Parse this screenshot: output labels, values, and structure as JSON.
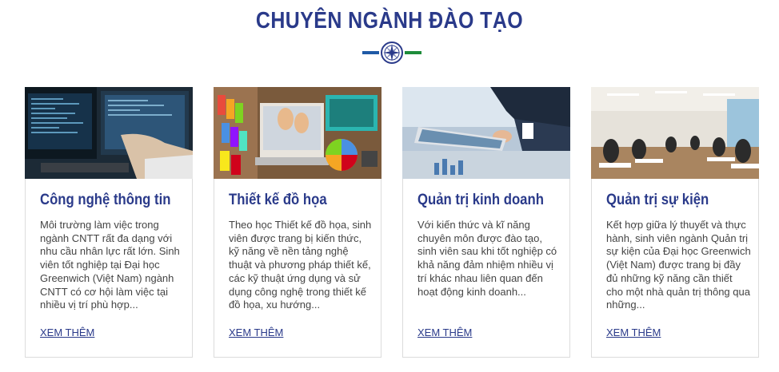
{
  "section": {
    "title": "CHUYÊN NGÀNH ĐÀO TẠO"
  },
  "colors": {
    "title": "#2a3a8a",
    "divider_left": "#1f5aa6",
    "divider_right": "#1e8c3a",
    "text": "#444444"
  },
  "cards": [
    {
      "title": "Công nghệ thông tin",
      "description": "Môi trường làm việc trong ngành CNTT rất đa dạng với nhu cầu nhân lực rất lớn. Sinh viên tốt nghiệp tại Đại học Greenwich (Việt Nam) ngành CNTT có cơ hội làm việc tại nhiều vị trí phù hợp...",
      "link": "XEM THÊM"
    },
    {
      "title": "Thiết kế đồ họa",
      "description": "Theo học Thiết kế đồ họa, sinh viên được trang bị kiến thức, kỹ năng về nền tảng nghệ thuật và phương pháp thiết kế, các kỹ thuật ứng dụng và sử dụng công nghệ trong thiết kế đồ họa, xu hướng...",
      "link": "XEM THÊM"
    },
    {
      "title": "Quản trị kinh doanh",
      "description": "Với kiến thức và kĩ năng chuyên môn được đào tạo, sinh viên sau khi tốt nghiệp có khả năng đảm nhiệm nhiều vị trí khác nhau liên quan đến hoạt động kinh doanh...",
      "link": "XEM THÊM"
    },
    {
      "title": "Quản trị sự kiện",
      "description": "Kết hợp giữa lý thuyết và thực hành, sinh viên ngành Quản trị sự kiện của Đại học Greenwich (Việt Nam) được trang bị đầy đủ những kỹ năng cần thiết cho một nhà quản trị thông qua những...",
      "link": "XEM THÊM"
    }
  ]
}
